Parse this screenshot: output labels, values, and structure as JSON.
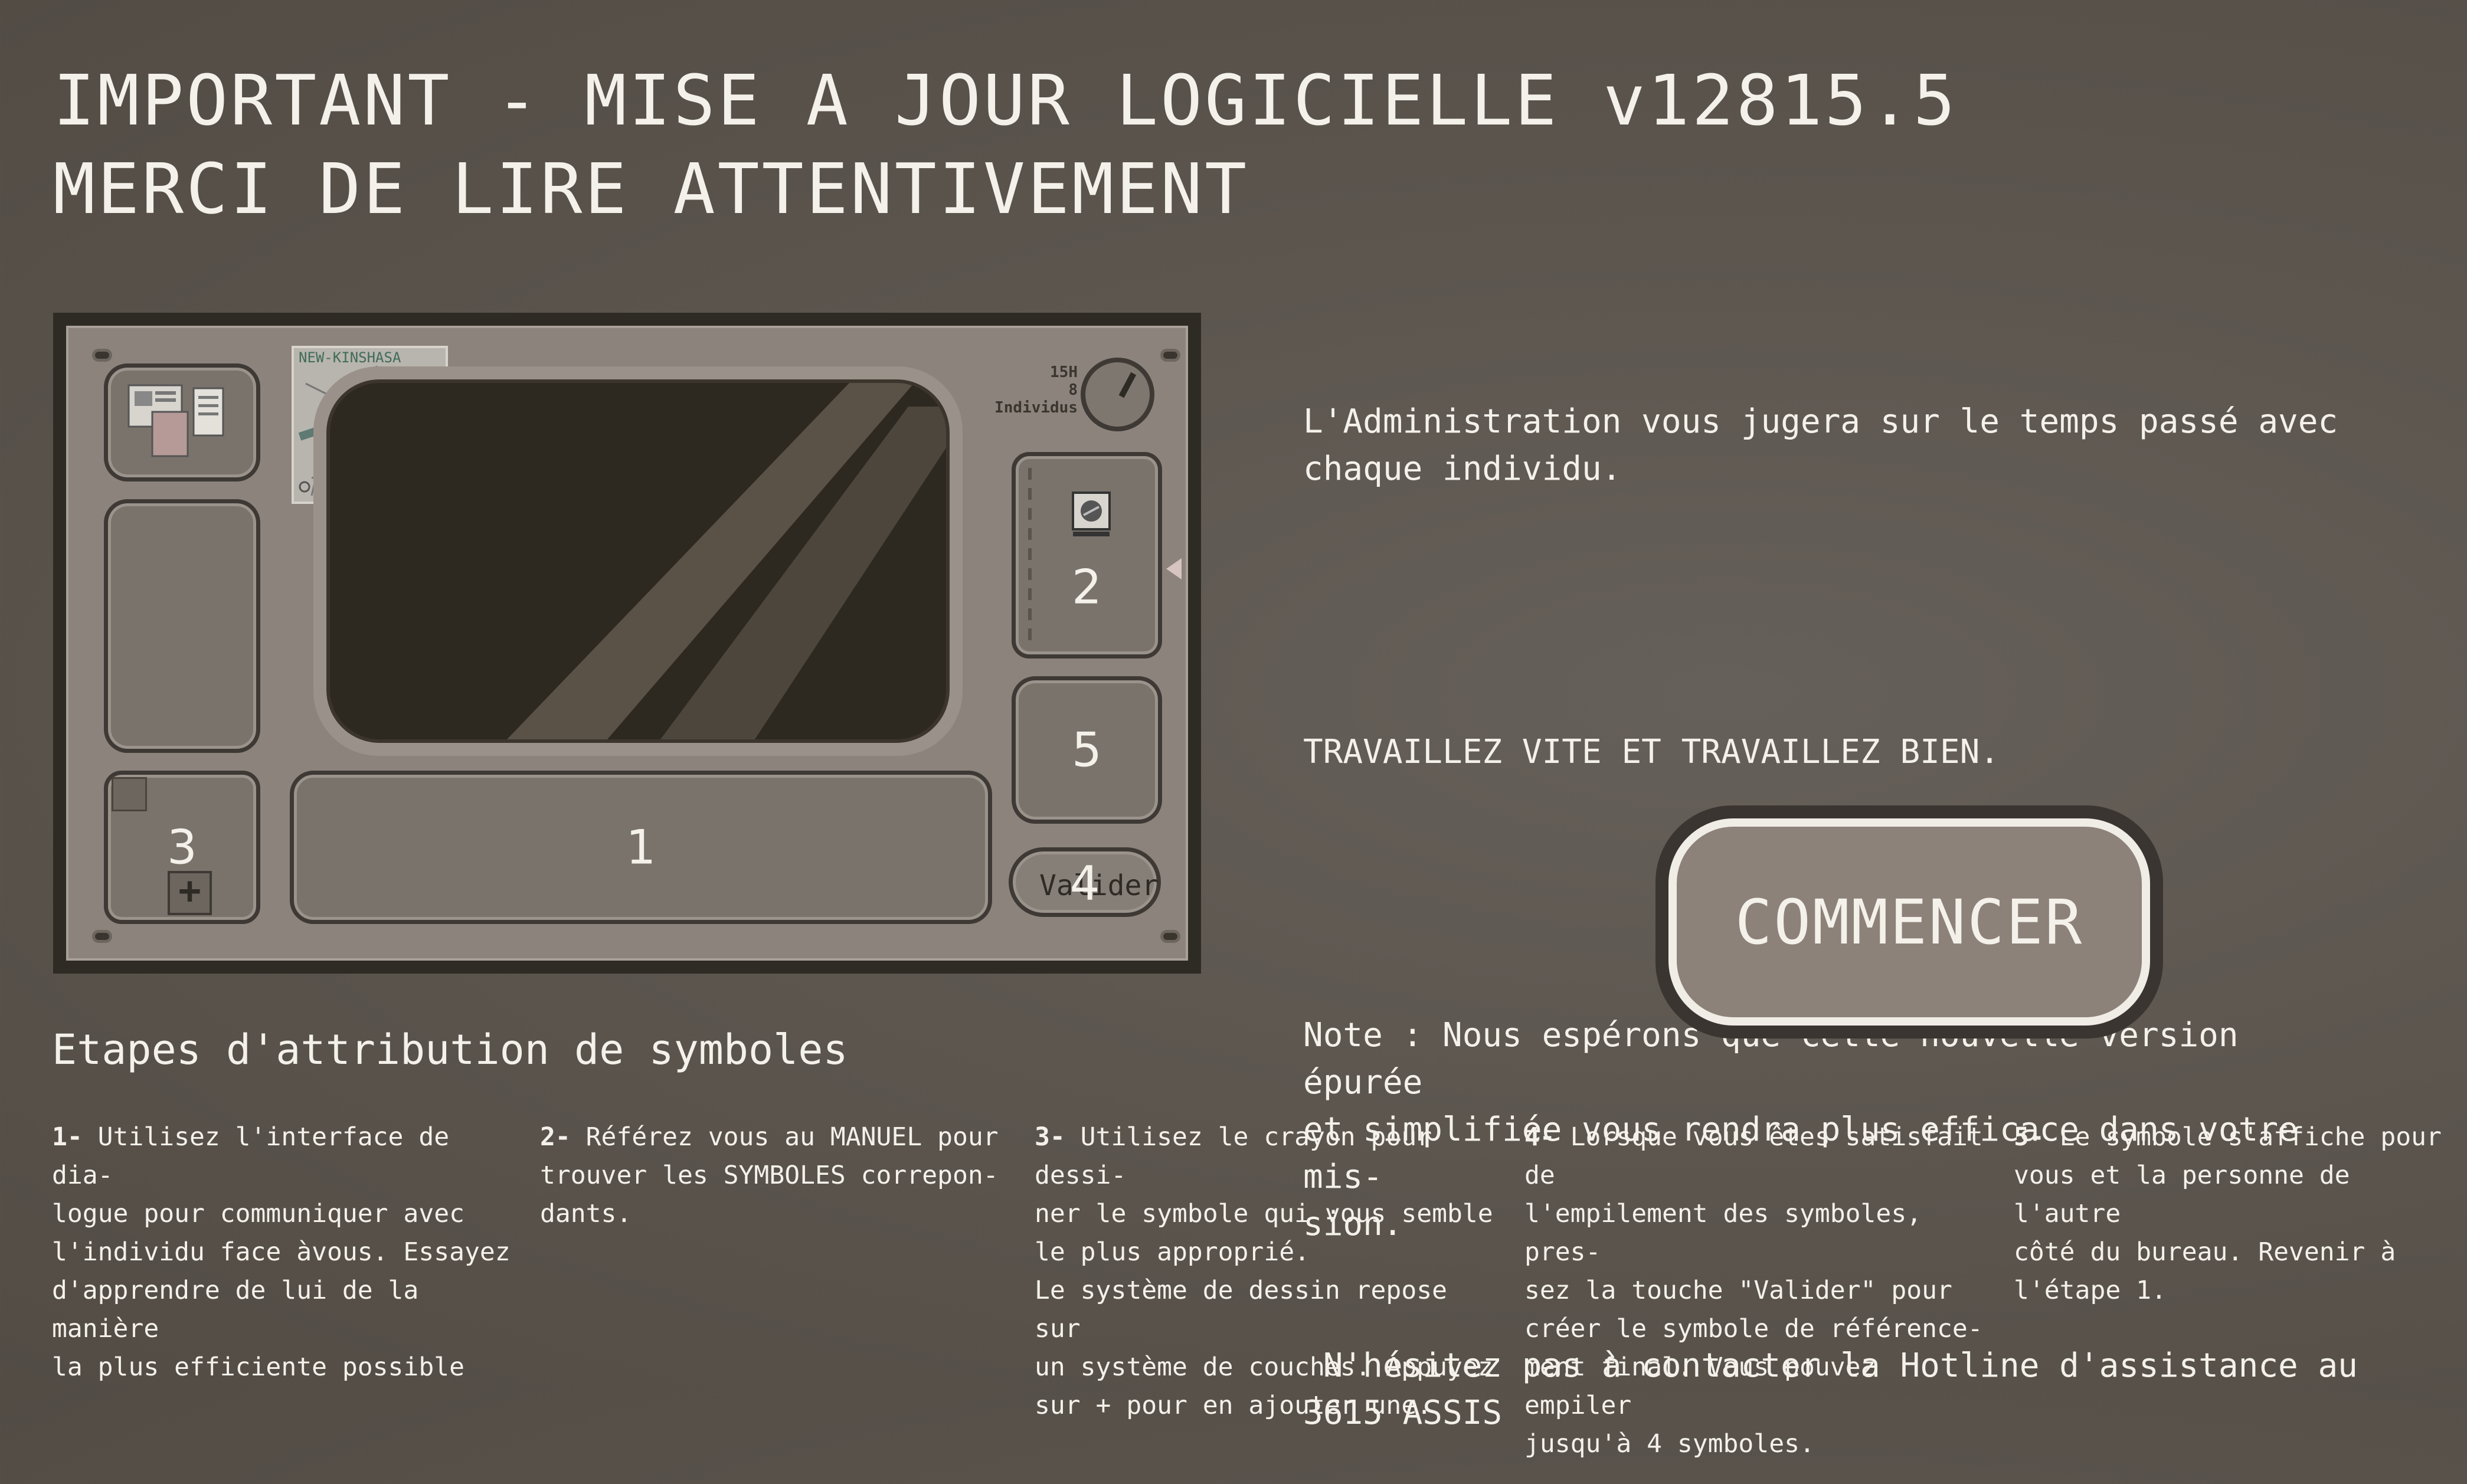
{
  "header": {
    "title_line1": "IMPORTANT - MISE A JOUR LOGICIELLE v12815.5",
    "title_line2": "MERCI DE LIRE ATTENTIVEMENT"
  },
  "mockup": {
    "map_label": "NEW-KINSHASA",
    "hud_time": "15H",
    "hud_count": "8",
    "hud_label": "Individus",
    "panel_1": "1",
    "panel_2": "2",
    "panel_3": "3",
    "panel_4": "4",
    "panel_5": "5",
    "valider_label": "Valider",
    "plus_symbol": "+"
  },
  "info": {
    "line1": "L'Administration vous jugera sur le temps passé avec\nchaque individu.",
    "line2": "TRAVAILLEZ VITE ET TRAVAILLEZ BIEN.",
    "line3": "Note : Nous espérons que cette nouvelle version épurée\net simplifiée vous rendra plus efficace dans votre mis-\nsion.",
    "line4": " N'hésitez pas à contacter la Hotline d'assistance au\n3615 ASSIS"
  },
  "start_button": "COMMENCER",
  "steps": {
    "title": "Etapes d'attribution de symboles",
    "items": [
      {
        "num": "1-",
        "text": " Utilisez l'interface de dia-\nlogue pour communiquer avec\nl'individu face àvous. Essayez\nd'apprendre de lui de la manière\nla plus efficiente possible"
      },
      {
        "num": "2-",
        "text": " Référez vous au MANUEL pour\ntrouver les SYMBOLES correpon-\ndants."
      },
      {
        "num": "3-",
        "text": " Utilisez le crayon pour dessi-\nner le symbole qui vous semble\nle plus approprié.\nLe système de dessin repose sur\nun système de couches. Appuyez\nsur + pour en ajouter une."
      },
      {
        "num": "4-",
        "text": " Lorsque vous êtes satisfait de\nl'empilement des symboles, pres-\nsez la touche \"Valider\" pour\ncréer le symbole de référence-\nment final. Vous pouvez empiler\njusqu'à 4 symboles."
      },
      {
        "num": "5-",
        "text": " Le symbole s'affiche pour\nvous et la personne de l'autre\ncôté du bureau. Revenir à\nl'étape 1."
      }
    ]
  }
}
